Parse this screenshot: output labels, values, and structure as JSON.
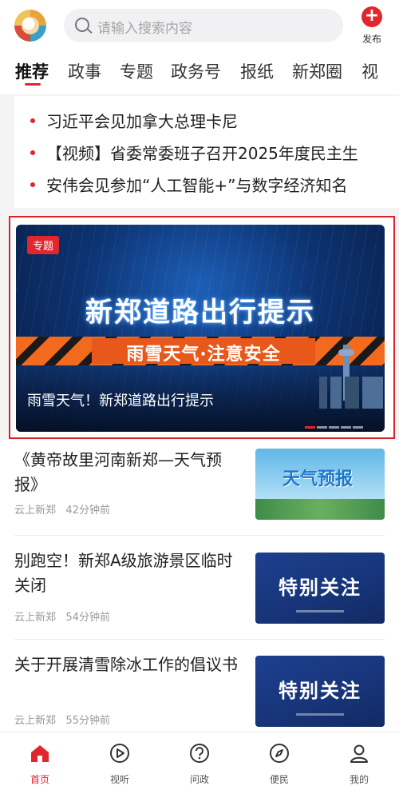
{
  "header": {
    "search_placeholder": "请输入搜索内容",
    "publish_label": "发布"
  },
  "tabs": [
    "推荐",
    "政事",
    "专题",
    "政务号",
    "报纸",
    "新郑圈",
    "视"
  ],
  "headlines": [
    "习近平会见加拿大总理卡尼",
    "【视频】省委常委班子召开2025年度民主生",
    "安伟会见参加“人工智能+”与数字经济知名"
  ],
  "banner": {
    "badge": "专题",
    "title": "新郑道路出行提示",
    "subtitle": "雨雪天气·注意安全",
    "caption": "雨雪天气！新郑道路出行提示"
  },
  "articles": [
    {
      "title": "《黄帝故里河南新郑—天气预报》",
      "source": "云上新郑",
      "time": "42分钟前",
      "thumb_text": "天气预报"
    },
    {
      "title": "别跑空！新郑A级旅游景区临时关闭",
      "source": "云上新郑",
      "time": "54分钟前",
      "thumb_text": "特别关注"
    },
    {
      "title": "关于开展清雪除冰工作的倡议书",
      "source": "云上新郑",
      "time": "55分钟前",
      "thumb_text": "特别关注"
    }
  ],
  "bottom_nav": [
    {
      "label": "首页",
      "icon": "home-icon",
      "active": true
    },
    {
      "label": "视听",
      "icon": "play-icon",
      "active": false
    },
    {
      "label": "问政",
      "icon": "question-icon",
      "active": false
    },
    {
      "label": "便民",
      "icon": "compass-icon",
      "active": false
    },
    {
      "label": "我的",
      "icon": "user-icon",
      "active": false
    }
  ],
  "colors": {
    "accent": "#e2262d",
    "banner_dark": "#071a3d"
  }
}
